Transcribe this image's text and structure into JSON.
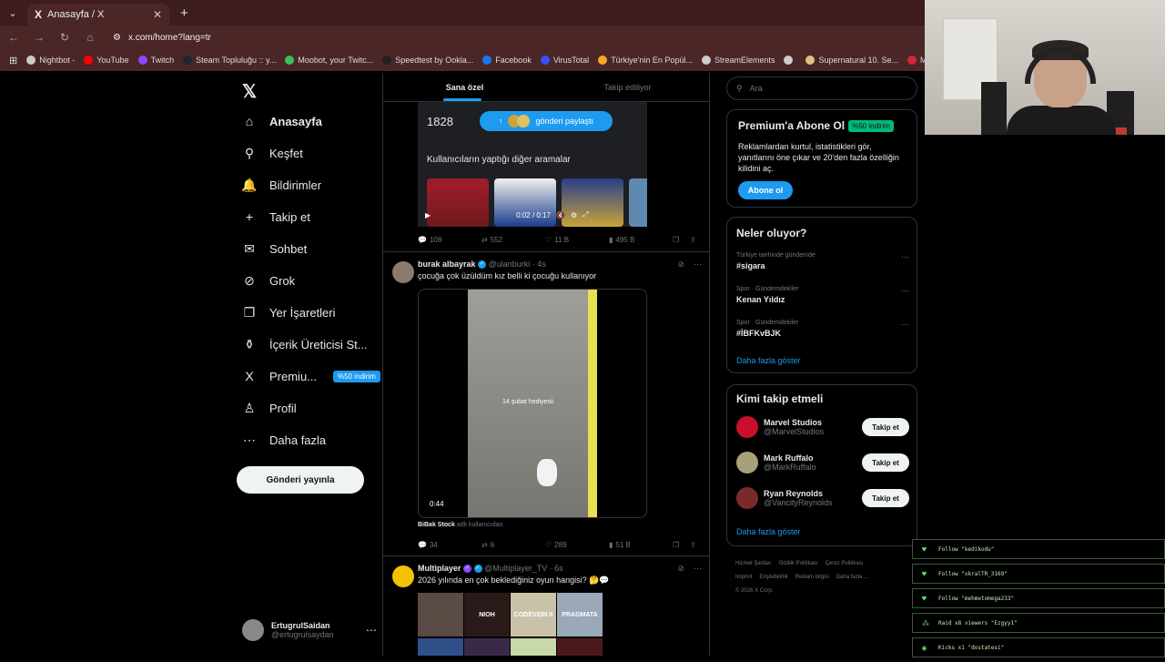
{
  "browser": {
    "tab_title": "Anasayfa / X",
    "url": "x.com/home?lang=tr",
    "bookmarks": [
      {
        "label": "Nightbot -",
        "color": "#cccccc"
      },
      {
        "label": "YouTube",
        "color": "#ff0000"
      },
      {
        "label": "Twitch",
        "color": "#9146ff"
      },
      {
        "label": "Steam Topluluğu :: y...",
        "color": "#1b2838"
      },
      {
        "label": "Moobot, your Twitc...",
        "color": "#39c05a"
      },
      {
        "label": "Speedtest by Ookla...",
        "color": "#222222"
      },
      {
        "label": "Facebook",
        "color": "#1877f2"
      },
      {
        "label": "VirusTotal",
        "color": "#394eff"
      },
      {
        "label": "Türkiye'nin En Popül...",
        "color": "#f5a623"
      },
      {
        "label": "StreamElements",
        "color": "#cccccc"
      },
      {
        "label": "",
        "color": "#cccccc"
      },
      {
        "label": "Supernatural 10. Se...",
        "color": "#e0c080"
      },
      {
        "label": "Mersin İstanbul O",
        "color": "#d0273b"
      }
    ]
  },
  "nav": {
    "items": [
      {
        "label": "Anasayfa",
        "icon": "⌂"
      },
      {
        "label": "Keşfet",
        "icon": "⚲"
      },
      {
        "label": "Bildirimler",
        "icon": "🔔"
      },
      {
        "label": "Takip et",
        "icon": "+"
      },
      {
        "label": "Sohbet",
        "icon": "✉"
      },
      {
        "label": "Grok",
        "icon": "⊘"
      },
      {
        "label": "Yer İşaretleri",
        "icon": "❐"
      },
      {
        "label": "İçerik Üreticisi St...",
        "icon": "⚱"
      },
      {
        "label": "Premiu...",
        "icon": "X",
        "badge": "%50 indirim"
      },
      {
        "label": "Profil",
        "icon": "♙"
      },
      {
        "label": "Daha fazla",
        "icon": "⋯"
      }
    ],
    "post_button": "Gönderi yayınla",
    "account": {
      "name": "ErtugrulSaidan",
      "handle": "@ertugrulsaydan"
    }
  },
  "feed": {
    "tabs": [
      "Sana özel",
      "Takip ediliyor"
    ],
    "media_card": {
      "count": "1828",
      "share_label": "gönderi paylaştı",
      "related": "Kullanıcıların yaptığı diğer aramalar",
      "video_time": "0:02 / 0:17"
    },
    "tweet0_actions": {
      "reply": "108",
      "retweet": "552",
      "like": "11 B",
      "views": "495 B"
    },
    "tweets": [
      {
        "name": "burak albayrak",
        "handle": "@ulanburki · 4s",
        "text": "çocuğa çok üzüldüm kız belli ki çocuğu kullanıyor",
        "video_caption": "14 şubat hediyesii",
        "video_duration": "0:44",
        "source_prefix": "BiBak Stock",
        "source_suffix": "adlı kullanıcıdan",
        "actions": {
          "reply": "34",
          "retweet": "6",
          "like": "289",
          "views": "51 B"
        }
      },
      {
        "name": "Multiplayer",
        "handle": "@Multiplayer_TV · 6s",
        "text": "2026 yılında en çok beklediğiniz oyun hangisi? 🤔💬",
        "games": [
          "",
          "NIOH",
          "CODEVEIN II",
          "PRAGMATA",
          "",
          "",
          "",
          ""
        ]
      }
    ]
  },
  "right": {
    "search_placeholder": "Ara",
    "premium": {
      "title": "Premium'a Abone Ol",
      "badge": "%50 indirim",
      "desc": "Reklamlardan kurtul, istatistikleri gör, yanıtlarını öne çıkar ve 20'den fazla özelliğin kilidini aç.",
      "button": "Abone ol"
    },
    "trends": {
      "title": "Neler oluyor?",
      "items": [
        {
          "context": "Türkiye tarihinde gündemde",
          "name": "#sigara"
        },
        {
          "context": "Spor · Gündemdekiler",
          "name": "Kenan Yıldız"
        },
        {
          "context": "Spor · Gündemdekiler",
          "name": "#İBFKvBJK"
        }
      ],
      "show_more": "Daha fazla göster"
    },
    "who_to_follow": {
      "title": "Kimi takip etmeli",
      "items": [
        {
          "name": "Marvel Studios",
          "handle": "@MarvelStudios",
          "color": "#c8102e"
        },
        {
          "name": "Mark Ruffalo",
          "handle": "@MarkRuffalo",
          "color": "#a8a07a"
        },
        {
          "name": "Ryan Reynolds",
          "handle": "@VancityReynolds",
          "color": "#7a2a2a"
        }
      ],
      "follow_label": "Takip et",
      "show_more": "Daha fazla göster"
    },
    "footer": [
      "Hizmet Şartları",
      "Gizlilik Politikası",
      "Çerez Politikası",
      "Imprint",
      "Erişilebilirlik",
      "Reklam bilgisi",
      "Daha fazla ...",
      "© 2026 X Corp."
    ]
  },
  "stream_events": [
    {
      "icon": "♥",
      "text": "Follow \"kedikodu\""
    },
    {
      "icon": "♥",
      "text": "Follow \"xkralTR_3169\""
    },
    {
      "icon": "♥",
      "text": "Follow \"mehmetomega233\""
    },
    {
      "icon": "⁂",
      "text": "Raid x8 viewers \"Ezgyy1\""
    },
    {
      "icon": "◉",
      "text": "Kicks x1 \"dostatesi\""
    }
  ]
}
